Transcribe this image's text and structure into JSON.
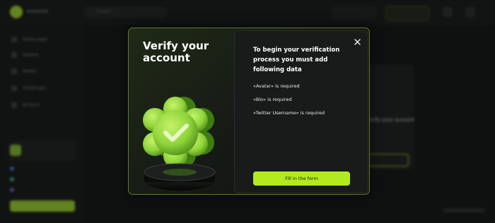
{
  "background": {
    "logo_text": "xxxxxx",
    "search_placeholder": "Search",
    "sidebar_items": [
      "Home page",
      "Explore",
      "Assets",
      "Challenges",
      "Account"
    ],
    "card_title": "Verify your account"
  },
  "modal": {
    "heading": "Verify your account",
    "intro": "To begin your verification process you must add following data",
    "requirements": [
      "«Avatar» is required",
      "«Bio» is required",
      "«Twitter Username» is required"
    ],
    "cta_label": "Fill in the form",
    "close_icon": "close-icon",
    "badge_icon": "verified-badge-icon"
  },
  "colors": {
    "accent": "#b2ea1f",
    "modal_border": "#5f7a2a",
    "panel_bg": "#191b1a",
    "page_bg": "#0f1110"
  }
}
